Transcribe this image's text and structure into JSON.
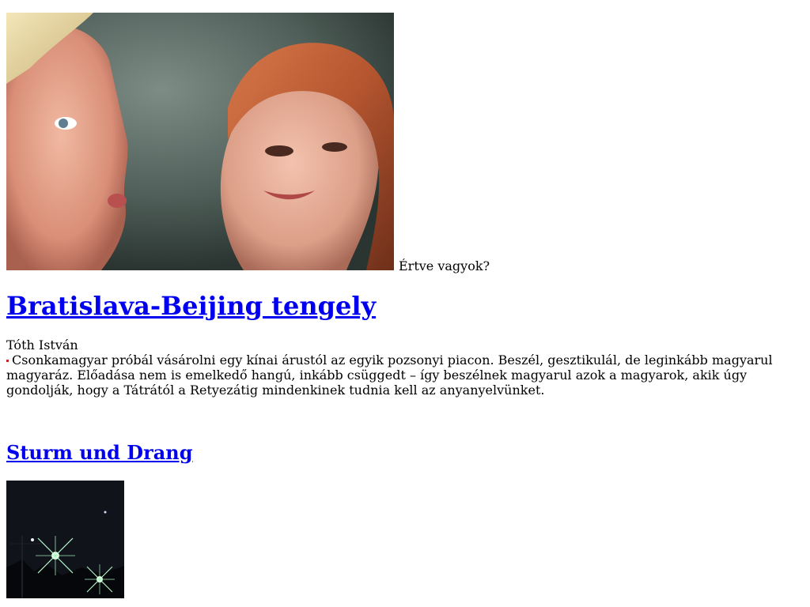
{
  "hero": {
    "caption": "Értve vagyok?"
  },
  "article1": {
    "title": "Bratislava-Beijing tengely",
    "author": "Tóth István",
    "lead": "Csonkamagyar próbál vásárolni egy kínai árustól az egyik pozsonyi piacon. Beszél, gesztikulál, de leginkább magyarul magyaráz. Előadása nem is emelkedő hangú, inkább csüggedt – így beszélnek magyarul azok a magyarok, akik úgy gondolják, hogy a Tátrától a Retyezátig mindenkinek tudnia kell az anyanyelvünket."
  },
  "article2": {
    "title": "Sturm und Drang"
  },
  "colors": {
    "link": "#0000ee",
    "bullet": "#cc2222"
  }
}
